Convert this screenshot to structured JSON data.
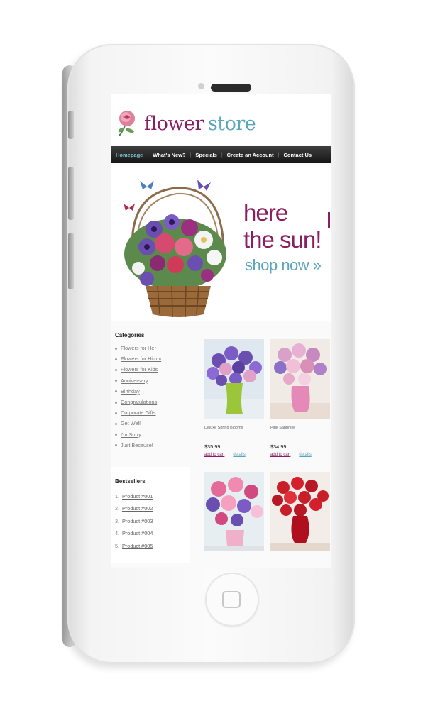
{
  "store": {
    "logo_word1": "flower",
    "logo_word2": "store"
  },
  "nav": {
    "items": [
      "Homepage",
      "What's New?",
      "Specials",
      "Create an Account",
      "Contact Us"
    ],
    "active": "Homepage"
  },
  "banner": {
    "line1": "here",
    "line2": "the sun!",
    "cta": "shop now »"
  },
  "sidebar": {
    "categories_heading": "Categories",
    "categories": [
      "Flowers for Her",
      "Flowers for Him »",
      "Flowers for Kids",
      "Anniversary",
      "Birthday",
      "Congratulations",
      "Corporate Gifts",
      "Get Well",
      "I'm Sorry",
      "Just Because!"
    ],
    "bestsellers_heading": "Bestsellers",
    "bestsellers": [
      {
        "num": "1.",
        "label": "Product #001"
      },
      {
        "num": "2.",
        "label": "Product #002"
      },
      {
        "num": "3.",
        "label": "Product #003"
      },
      {
        "num": "4.",
        "label": "Product #004"
      },
      {
        "num": "5.",
        "label": "Product #005"
      }
    ]
  },
  "products": [
    {
      "name": "Deluxe Spring Blooms",
      "price": "$35.99",
      "add_label": "add to cart",
      "details_label": "details"
    },
    {
      "name": "Pink Sapphire",
      "price": "$34.99",
      "add_label": "add to cart",
      "details_label": "details"
    },
    {
      "name": "",
      "price": "",
      "add_label": "",
      "details_label": ""
    },
    {
      "name": "",
      "price": "",
      "add_label": "",
      "details_label": ""
    }
  ],
  "colors": {
    "brand_plum": "#8a1e62",
    "brand_teal": "#5aa6bd",
    "nav_bg": "#1f1f1f"
  },
  "icons": {
    "camera": "camera-icon",
    "speaker": "speaker-grille",
    "home": "home-button-icon",
    "logo": "rose-logo-icon"
  }
}
